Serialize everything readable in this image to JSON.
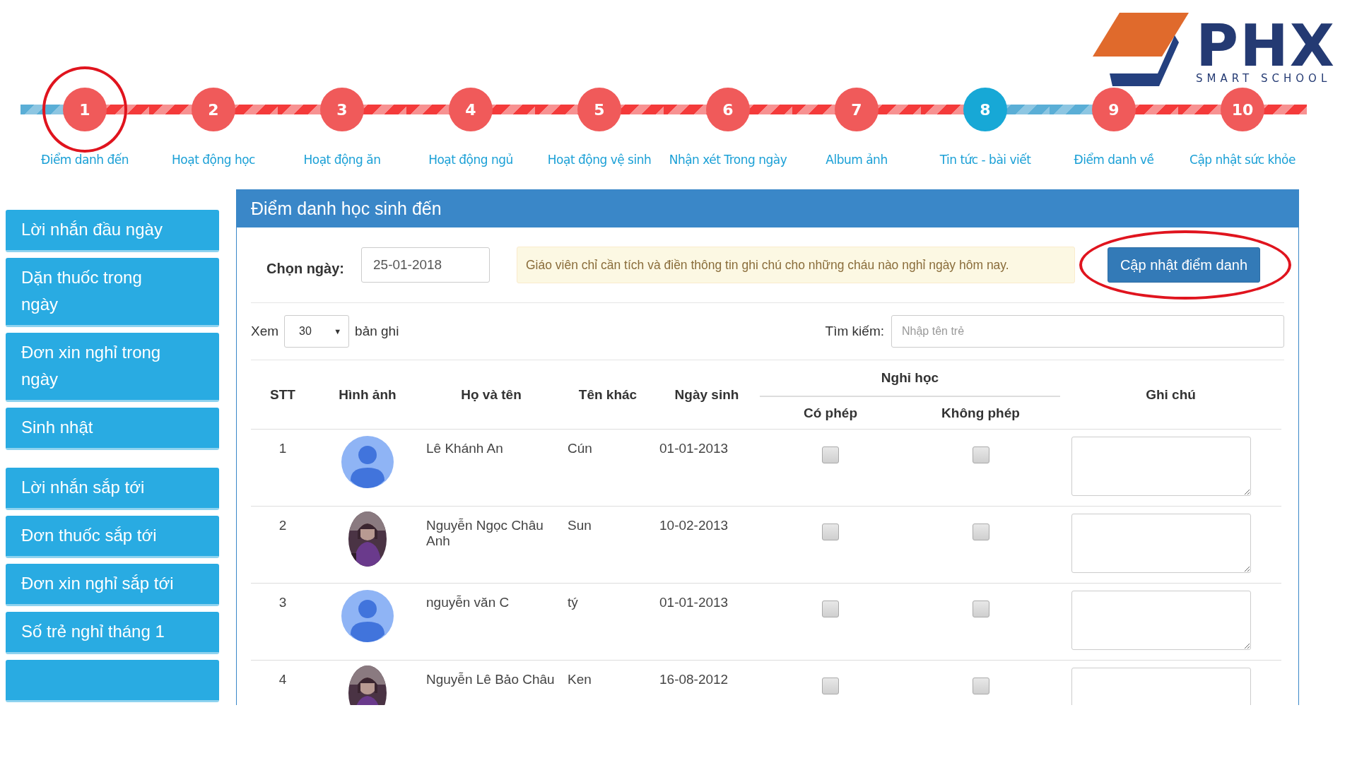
{
  "logo": {
    "name": "PHX",
    "tagline": "SMART SCHOOL"
  },
  "steps": [
    {
      "number": "1",
      "label": "Điểm danh đến",
      "current": false,
      "circled": true
    },
    {
      "number": "2",
      "label": "Hoạt động học",
      "current": false
    },
    {
      "number": "3",
      "label": "Hoạt động ăn",
      "current": false
    },
    {
      "number": "4",
      "label": "Hoạt động ngủ",
      "current": false
    },
    {
      "number": "5",
      "label": "Hoạt động vệ sinh",
      "current": false
    },
    {
      "number": "6",
      "label": "Nhận xét Trong ngày",
      "current": false
    },
    {
      "number": "7",
      "label": "Album ảnh",
      "current": false
    },
    {
      "number": "8",
      "label": "Tin tức - bài viết",
      "current": true
    },
    {
      "number": "9",
      "label": "Điểm danh về",
      "current": false
    },
    {
      "number": "10",
      "label": "Cập nhật sức khỏe",
      "current": false
    }
  ],
  "sidebar": {
    "groups": [
      [
        {
          "label": "Lời nhắn đầu ngày"
        },
        {
          "label": "Dặn thuốc trong ngày"
        },
        {
          "label": "Đơn xin nghỉ trong ngày"
        },
        {
          "label": "Sinh nhật"
        }
      ],
      [
        {
          "label": "Lời nhắn sắp tới"
        },
        {
          "label": "Đơn thuốc sắp tới"
        },
        {
          "label": "Đơn xin nghỉ sắp tới"
        },
        {
          "label": "Số trẻ nghỉ tháng 1"
        }
      ]
    ],
    "more_below": true
  },
  "panel": {
    "title": "Điểm danh học sinh đến",
    "date_label": "Chọn ngày:",
    "date_value": "25-01-2018",
    "notice": "Giáo viên chỉ cần tích và điền thông tin ghi chú cho những cháu nào nghỉ ngày hôm nay.",
    "update_button": {
      "label": "Cập nhật điểm danh",
      "circled": true
    },
    "page_size": {
      "prefix": "Xem",
      "value": "30",
      "caret": "▼",
      "suffix": "bản ghi"
    },
    "search": {
      "label": "Tìm kiếm:",
      "placeholder": "Nhập tên trẻ"
    },
    "table": {
      "columns": [
        "STT",
        "Hình ảnh",
        "Họ và tên",
        "Tên khác",
        "Ngày sinh"
      ],
      "group_header": "Nghỉ học",
      "sub_columns": [
        "Có phép",
        "Không phép"
      ],
      "note_column": "Ghi chú",
      "rows": [
        {
          "stt": "1",
          "kind": "default",
          "name": "Lê Khánh An",
          "nickname": "Cún",
          "birthdate": "01-01-2013",
          "excused": false,
          "unexcused": false
        },
        {
          "stt": "2",
          "kind": "picture",
          "name": "Nguyễn Ngọc Châu Anh",
          "nickname": "Sun",
          "birthdate": "10-02-2013",
          "excused": false,
          "unexcused": false
        },
        {
          "stt": "3",
          "kind": "default",
          "name": "nguyễn văn C",
          "nickname": "tý",
          "birthdate": "01-01-2013",
          "excused": false,
          "unexcused": false
        },
        {
          "stt": "4",
          "kind": "picture",
          "name": "Nguyễn Lê Bảo Châu",
          "nickname": "Ken",
          "birthdate": "16-08-2012",
          "excused": false,
          "unexcused": false
        }
      ]
    }
  }
}
